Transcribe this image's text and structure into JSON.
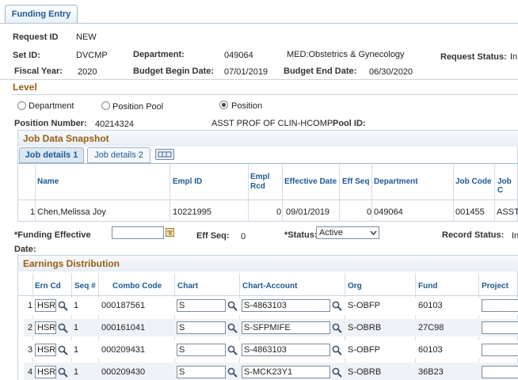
{
  "tab": {
    "label": "Funding Entry"
  },
  "header": {
    "request_id_label": "Request ID",
    "request_id": "NEW",
    "setid_label": "Set ID:",
    "setid": "DVCMP",
    "department_label": "Department:",
    "department": "049064",
    "department_desc": "MED:Obstetrics & Gynecology",
    "request_status_label": "Request Status:",
    "request_status": "In",
    "fiscal_year_label": "Fiscal Year:",
    "fiscal_year": "2020",
    "budget_begin_label": "Budget Begin Date:",
    "budget_begin": "07/01/2019",
    "budget_end_label": "Budget End Date:",
    "budget_end": "06/30/2020"
  },
  "level": {
    "title": "Level",
    "options": [
      "Department",
      "Position Pool",
      "Position"
    ],
    "selected": "Position",
    "position_number_label": "Position Number:",
    "position_number": "40214324",
    "position_title": "ASST PROF OF CLIN-HCOMP",
    "pool_id_label": "Pool ID:"
  },
  "job_snapshot": {
    "title": "Job Data Snapshot",
    "tabs": [
      "Job details 1",
      "Job details 2"
    ],
    "columns": [
      "Name",
      "Empl ID",
      "Empl Rcd",
      "Effective Date",
      "Eff Seq",
      "Department",
      "Job Code",
      "Job C"
    ],
    "row": {
      "num": "1",
      "name": "Chen,Melissa Joy",
      "emplid": "10221995",
      "rcd": "0",
      "effdt": "09/01/2019",
      "effseq": "0",
      "dept": "049064",
      "jobcode": "001455",
      "jobc": "ASST"
    }
  },
  "funding": {
    "eff_label_1": "*Funding Effective",
    "eff_label_2": "Date:",
    "eff_value": "",
    "effseq_label": "Eff Seq:",
    "effseq": "0",
    "status_label": "*Status:",
    "status": "Active",
    "record_status_label": "Record Status:",
    "record_status": "In"
  },
  "earnings": {
    "title": "Earnings Distribution",
    "columns": [
      "Ern Cd",
      "Seq #",
      "Combo Code",
      "Chart",
      "Chart-Account",
      "Org",
      "Fund",
      "Project"
    ],
    "rows": [
      {
        "n": "1",
        "erncd": "HSR",
        "seq": "1",
        "combo": "000187561",
        "chart": "S",
        "account": "S-4863103",
        "org": "S-OBFP",
        "fund": "60103",
        "project": ""
      },
      {
        "n": "2",
        "erncd": "HSR",
        "seq": "1",
        "combo": "000161041",
        "chart": "S",
        "account": "S-SFPMIFE",
        "org": "S-OBRB",
        "fund": "27C98",
        "project": ""
      },
      {
        "n": "3",
        "erncd": "HSR",
        "seq": "1",
        "combo": "000209431",
        "chart": "S",
        "account": "S-4863103",
        "org": "S-OBFP",
        "fund": "60103",
        "project": ""
      },
      {
        "n": "4",
        "erncd": "HSR",
        "seq": "1",
        "combo": "000209430",
        "chart": "S",
        "account": "S-MCK23Y1",
        "org": "S-OBRB",
        "fund": "36B23",
        "project": ""
      }
    ]
  },
  "colors": {
    "link_blue": "#1d5a94",
    "section_brown": "#9a5f12",
    "row_alt": "#eef3f8"
  }
}
